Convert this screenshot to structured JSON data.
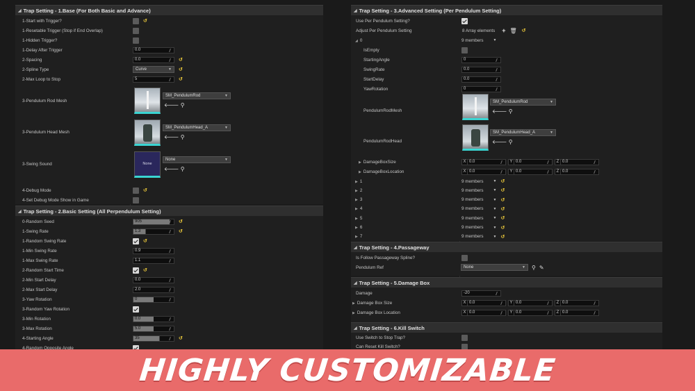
{
  "banner": "HIGHLY CUSTOMIZABLE",
  "left": {
    "base": {
      "title": "Trap Setting - 1.Base (For Both Basic and Advance)",
      "start_with_trigger": "1-Start with Trigger?",
      "resetable_trigger": "1-Resetable Trigger (Stop if End Overlap)",
      "hidden_trigger": "1-Hidden Trigger?",
      "delay_after_trigger": "1-Delay After Trigger",
      "delay_after_trigger_val": "0.0",
      "spacing": "2-Spacing",
      "spacing_val": "0.0",
      "spline_type": "2-Spline Type",
      "spline_type_val": "Curve",
      "max_loop": "2-Max Loop to Stop",
      "max_loop_val": "5",
      "rod_mesh": "3-Pendulum Rod Mesh",
      "rod_mesh_val": "SM_PendulumRod",
      "head_mesh": "3-Pendulum Head Mesh",
      "head_mesh_val": "SM_PendulumHead_A",
      "swing_sound": "3-Swing Sound",
      "swing_sound_thumb": "None",
      "swing_sound_val": "None",
      "debug_mode": "4-Debug Mode",
      "debug_show": "4-Set Debug Mode Show in Game"
    },
    "basic": {
      "title": "Trap Setting - 2.Basic Setting (All Perpendulum Setting)",
      "rows": [
        {
          "label": "0-Random Seed",
          "type": "slider",
          "val": "905",
          "fill": 0.9,
          "reset": true
        },
        {
          "label": "1-Swing Rate",
          "type": "slider",
          "val": "1.3",
          "fill": 0.3,
          "reset": true
        },
        {
          "label": "1-Random Swing Rate",
          "type": "check",
          "checked": true,
          "reset": true
        },
        {
          "label": "1-Min Swing Rate",
          "type": "num",
          "val": "0.9"
        },
        {
          "label": "1-Max Swing Rate",
          "type": "num",
          "val": "1.1"
        },
        {
          "label": "2-Random Start Time",
          "type": "check",
          "checked": true,
          "reset": true
        },
        {
          "label": "2-Min Start Delay",
          "type": "num",
          "val": "0.0"
        },
        {
          "label": "2-Max Start Delay",
          "type": "num",
          "val": "2.0"
        },
        {
          "label": "3-Yaw Rotation",
          "type": "slider",
          "val": "0",
          "fill": 0.5
        },
        {
          "label": "3-Random Yaw Rotation",
          "type": "check",
          "checked": true
        },
        {
          "label": "3-Min Rotation",
          "type": "slider",
          "val": "0.0",
          "fill": 0.5
        },
        {
          "label": "3-Max Rotation",
          "type": "slider",
          "val": "5.0",
          "fill": 0.5
        },
        {
          "label": "4-Starting Angle",
          "type": "slider",
          "val": "35",
          "fill": 0.65,
          "reset": true
        },
        {
          "label": "4-Random Opposite Angle",
          "type": "check",
          "checked": true
        }
      ]
    }
  },
  "right": {
    "advanced": {
      "title": "Trap Setting - 3.Advanced Setting (Per Pendulum Setting)",
      "use_per": "Use Per Pendulum Setting?",
      "adjust": "Adjust Per Pendulum Setting",
      "array_count": "8 Array elements",
      "idx0": "0",
      "members": "9 members",
      "is_empty": "IsEmpty",
      "starting_angle": "StartingAngle",
      "starting_angle_val": "0",
      "swing_rate": "SwingRate",
      "swing_rate_val": "0.0",
      "start_delay": "StartDelay",
      "start_delay_val": "0.0",
      "yaw": "YawRotation",
      "yaw_val": "0",
      "rod_mesh": "PendulumRodMesh",
      "rod_mesh_val": "SM_PendulumRod",
      "rod_head": "PendulumRodHead",
      "rod_head_val": "SM_PendulumHead_A",
      "dmg_size": "DamageBoxSize",
      "dmg_loc": "DamageBoxLocation",
      "vec_x": "X",
      "vec_y": "Y",
      "vec_z": "Z",
      "zero": "0.0",
      "elements": [
        "1",
        "2",
        "3",
        "4",
        "5",
        "6",
        "7"
      ]
    },
    "passage": {
      "title": "Trap Setting - 4.Passageway",
      "follow": "Is Follow Passageway Spline?",
      "ref": "Pendulum Ref",
      "ref_val": "None"
    },
    "damage": {
      "title": "Trap Setting - 5.Damage Box",
      "damage": "Damage",
      "damage_val": "-20",
      "size": "Damage Box Size",
      "loc": "Damage Box Location"
    },
    "kill": {
      "title": "Trap Setting - 6.Kill Switch",
      "use": "Use Switch to Stop Trap?",
      "can_reset": "Can Reset Kill Switch?"
    }
  }
}
